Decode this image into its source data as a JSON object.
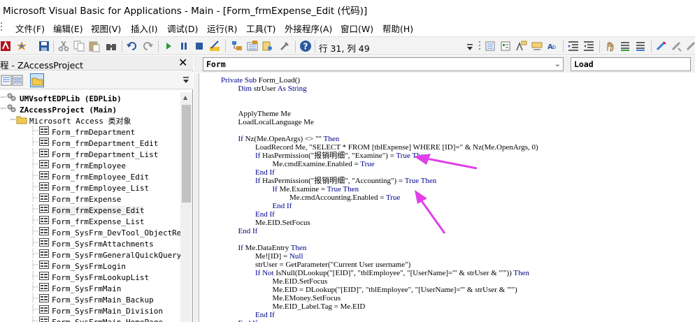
{
  "window": {
    "title": "Microsoft Visual Basic for Applications - Main - [Form_frmExpense_Edit (代码)]"
  },
  "menu": [
    {
      "label": "文件(F)"
    },
    {
      "label": "编辑(E)"
    },
    {
      "label": "视图(V)"
    },
    {
      "label": "插入(I)"
    },
    {
      "label": "调试(D)"
    },
    {
      "label": "运行(R)"
    },
    {
      "label": "工具(T)"
    },
    {
      "label": "外接程序(A)"
    },
    {
      "label": "窗口(W)"
    },
    {
      "label": "帮助(H)"
    }
  ],
  "toolbar": {
    "icons": [
      "access-view-icon",
      "insert-module-icon",
      "save-icon",
      "cut-icon",
      "copy-icon",
      "paste-icon",
      "find-icon",
      "undo-icon",
      "redo-icon",
      "run-icon",
      "break-icon",
      "reset-icon",
      "design-mode-icon",
      "project-explorer-icon",
      "properties-icon",
      "object-browser-icon",
      "toolbox-icon",
      "help-icon"
    ],
    "position": "行 31, 列 49",
    "right_icons": [
      "list-properties-icon",
      "list-constants-icon",
      "quick-info-icon",
      "parameter-info-icon",
      "complete-word-icon",
      "indent-icon",
      "outdent-icon",
      "toggle-breakpoint-icon",
      "comment-block-icon",
      "uncomment-block-icon",
      "toggle-bookmark-icon",
      "next-bookmark-icon"
    ]
  },
  "project_panel": {
    "title": "程 - ZAccessProject",
    "close_label": "✕",
    "tools": [
      "view-code-icon",
      "view-object-icon",
      "toggle-folders-icon"
    ],
    "tree": [
      {
        "label": "UMVsoftEDPLib (EDPLib)",
        "level": 0,
        "kind": "project",
        "bold": true
      },
      {
        "label": "ZAccessProject (Main)",
        "level": 0,
        "kind": "project",
        "bold": true
      },
      {
        "label": "Microsoft Access 类对象",
        "level": 1,
        "kind": "folder"
      },
      {
        "label": "Form_frmDepartment",
        "level": 2,
        "kind": "form"
      },
      {
        "label": "Form_frmDepartment_Edit",
        "level": 2,
        "kind": "form"
      },
      {
        "label": "Form_frmDepartment_List",
        "level": 2,
        "kind": "form"
      },
      {
        "label": "Form_frmEmployee",
        "level": 2,
        "kind": "form"
      },
      {
        "label": "Form_frmEmployee_Edit",
        "level": 2,
        "kind": "form"
      },
      {
        "label": "Form_frmEmployee_List",
        "level": 2,
        "kind": "form"
      },
      {
        "label": "Form_frmExpense",
        "level": 2,
        "kind": "form"
      },
      {
        "label": "Form_frmExpense_Edit",
        "level": 2,
        "kind": "form",
        "selected": true
      },
      {
        "label": "Form_frmExpense_List",
        "level": 2,
        "kind": "form"
      },
      {
        "label": "Form_SysFrm_DevTool_ObjectRepai",
        "level": 2,
        "kind": "form"
      },
      {
        "label": "Form_SysFrmAttachments",
        "level": 2,
        "kind": "form"
      },
      {
        "label": "Form_SysFrmGeneralQuickQuery",
        "level": 2,
        "kind": "form"
      },
      {
        "label": "Form_SysFrmLogin",
        "level": 2,
        "kind": "form"
      },
      {
        "label": "Form_SysFrmLookupList",
        "level": 2,
        "kind": "form"
      },
      {
        "label": "Form_SysFrmMain",
        "level": 2,
        "kind": "form"
      },
      {
        "label": "Form_SysFrmMain_Backup",
        "level": 2,
        "kind": "form"
      },
      {
        "label": "Form_SysFrmMain_Division",
        "level": 2,
        "kind": "form"
      },
      {
        "label": "Form_SysFrmMain_HomePage",
        "level": 2,
        "kind": "form"
      }
    ]
  },
  "code_window": {
    "object_combo": "Form",
    "procedure_combo": "Load",
    "lines": [
      {
        "indent": 0,
        "text": "Private Sub Form_Load()"
      },
      {
        "indent": 1,
        "text": "Dim strUser As String"
      },
      {
        "indent": 0,
        "text": ""
      },
      {
        "indent": 0,
        "text": ""
      },
      {
        "indent": 1,
        "text": "ApplyTheme Me"
      },
      {
        "indent": 1,
        "text": "LoadLocalLanguage Me"
      },
      {
        "indent": 0,
        "text": ""
      },
      {
        "indent": 1,
        "text": "If Nz(Me.OpenArgs) <> \"\" Then"
      },
      {
        "indent": 2,
        "text": "LoadRecord Me, \"SELECT * FROM [tblExpense] WHERE [ID]=\" & Nz(Me.OpenArgs, 0)"
      },
      {
        "indent": 2,
        "text": "If HasPermission(\"报销明细\", \"Examine\") = True Then"
      },
      {
        "indent": 3,
        "text": "Me.cmdExamine.Enabled = True"
      },
      {
        "indent": 2,
        "text": "End If"
      },
      {
        "indent": 2,
        "text": "If HasPermission(\"报销明细\", \"Accounting\") = True Then"
      },
      {
        "indent": 3,
        "text": "If Me.Examine = True Then"
      },
      {
        "indent": 4,
        "text": "Me.cmdAccounting.Enabled = True"
      },
      {
        "indent": 3,
        "text": "End If"
      },
      {
        "indent": 2,
        "text": "End If"
      },
      {
        "indent": 2,
        "text": "Me.EID.SetFocus"
      },
      {
        "indent": 1,
        "text": "End If"
      },
      {
        "indent": 0,
        "text": ""
      },
      {
        "indent": 1,
        "text": "If Me.DataEntry Then"
      },
      {
        "indent": 2,
        "text": "Me![ID] = Null"
      },
      {
        "indent": 2,
        "text": "strUser = GetParameter(\"Current User username\")"
      },
      {
        "indent": 2,
        "text": "If Not IsNull(DLookup(\"[EID]\", \"tblEmployee\", \"[UserName]='\" & strUser & \"'\")) Then"
      },
      {
        "indent": 3,
        "text": "Me.EID.SetFocus"
      },
      {
        "indent": 3,
        "text": "Me.EID = DLookup(\"[EID]\", \"tblEmployee\", \"[UserName]='\" & strUser & \"'\")"
      },
      {
        "indent": 3,
        "text": "Me.EMoney.SetFocus"
      },
      {
        "indent": 3,
        "text": "Me.EID_Label.Tag = Me.EID"
      },
      {
        "indent": 2,
        "text": "End If"
      },
      {
        "indent": 1,
        "text": "End If"
      }
    ]
  },
  "colors": {
    "keyword": "#00008b",
    "annotation_arrow": "#e040e8",
    "selection": "#f0f0f0"
  }
}
